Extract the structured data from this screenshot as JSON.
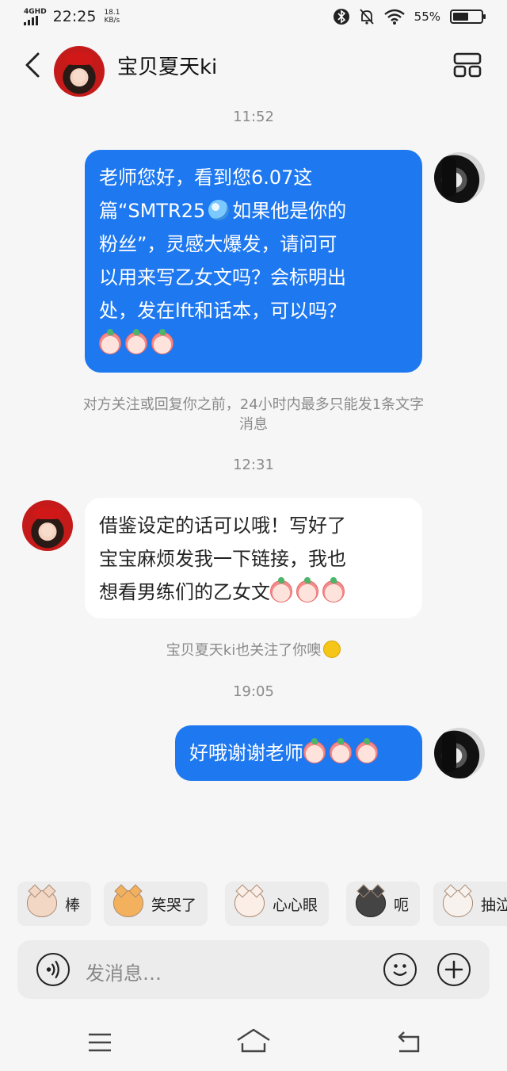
{
  "status_bar": {
    "network": "4G",
    "network_sub": "HD",
    "time": "22:25",
    "speed_value": "18.1",
    "speed_unit": "KB/s",
    "battery": "55%",
    "battery_level": 0.55
  },
  "header": {
    "title": "宝贝夏天ki"
  },
  "messages": [
    {
      "type": "timestamp",
      "text": "11:52"
    },
    {
      "type": "outgoing",
      "lines": [
        "老师您好，看到您6.07这",
        "篇“SMTR25",
        "如果他是你的",
        "粉丝”，灵感大爆发，请问可",
        "以用来写乙女文吗？会标明出",
        "处，发在lft和话本，可以吗？"
      ]
    },
    {
      "type": "system",
      "lines": [
        "对方关注或回复你之前，24小时内最多只能发1条文字",
        "消息"
      ]
    },
    {
      "type": "timestamp",
      "text": "12:31"
    },
    {
      "type": "incoming",
      "lines": [
        "借鉴设定的话可以哦！写好了",
        "宝宝麻烦发我一下链接，我也",
        "想看男练们的乙女文"
      ]
    },
    {
      "type": "system",
      "text": "宝贝夏天ki也关注了你噢"
    },
    {
      "type": "timestamp",
      "text": "19:05"
    },
    {
      "type": "outgoing",
      "text": "好哦谢谢老师"
    }
  ],
  "sticker_suggestions": [
    {
      "label": "棒"
    },
    {
      "label": "笑哭了"
    },
    {
      "label": "心心眼"
    },
    {
      "label": "呃"
    },
    {
      "label": "抽泣"
    }
  ],
  "input": {
    "placeholder": "发消息…"
  },
  "colors": {
    "outgoing_bubble": "#1e78f0",
    "incoming_bubble": "#ffffff",
    "background": "#f6f6f6"
  }
}
